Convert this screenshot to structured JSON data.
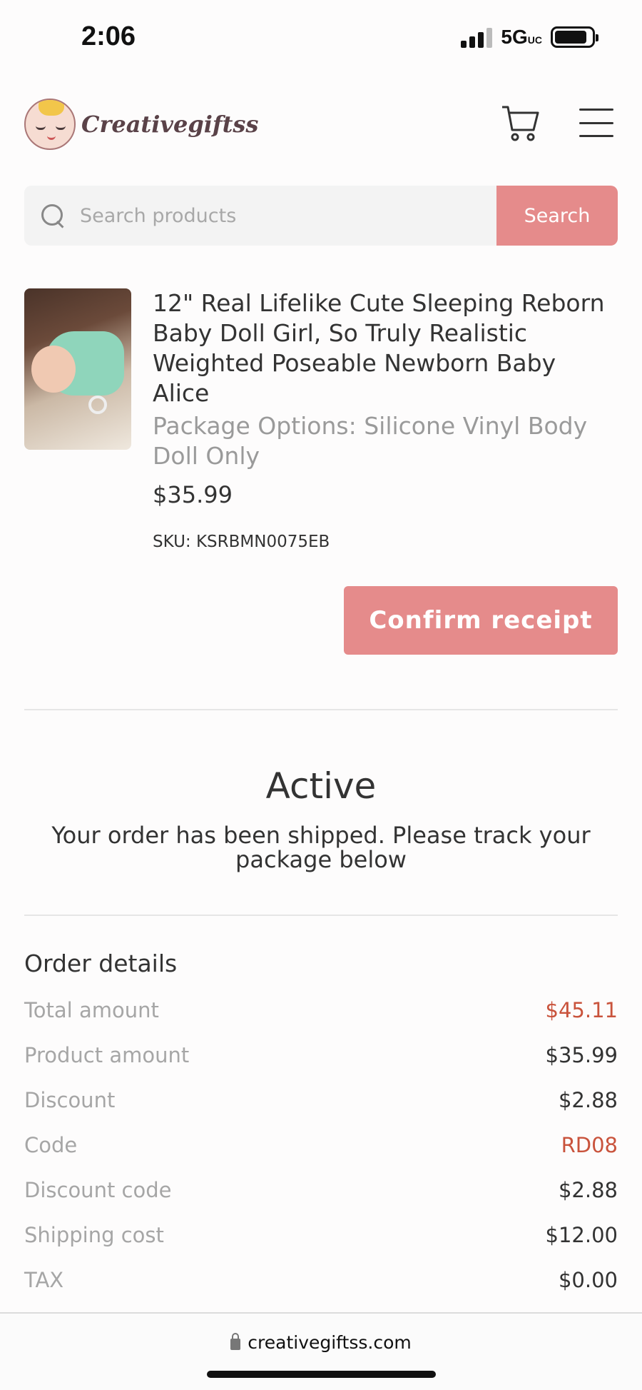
{
  "status_bar": {
    "time": "2:06",
    "network": "5G",
    "network_sup": "UC"
  },
  "header": {
    "logo_text": "Creativegiftss"
  },
  "search": {
    "placeholder": "Search products",
    "button_label": "Search"
  },
  "product": {
    "title": "12\" Real Lifelike Cute Sleeping Reborn Baby Doll Girl, So Truly Realistic Weighted Poseable Newborn Baby Alice",
    "option": "Package Options: Silicone Vinyl Body Doll Only",
    "price": "$35.99",
    "sku": "SKU: KSRBMN0075EB"
  },
  "actions": {
    "confirm_label": "Confirm receipt"
  },
  "order_status": {
    "title": "Active",
    "description": "Your order has been shipped. Please track your package below"
  },
  "order_details": {
    "heading": "Order details",
    "rows": [
      {
        "label": "Total amount",
        "value": "$45.11"
      },
      {
        "label": "Product amount",
        "value": "$35.99"
      },
      {
        "label": "Discount",
        "value": "$2.88"
      },
      {
        "label": "Code",
        "value": "RD08"
      },
      {
        "label": "Discount code",
        "value": "$2.88"
      },
      {
        "label": "Shipping cost",
        "value": "$12.00"
      },
      {
        "label": "TAX",
        "value": "$0.00"
      }
    ]
  },
  "browser": {
    "url": "creativegiftss.com"
  },
  "colors": {
    "accent": "#e58b8b",
    "highlight_text": "#c9533c"
  },
  "icons": [
    "search-icon",
    "cart-icon",
    "menu-icon",
    "lock-icon"
  ]
}
